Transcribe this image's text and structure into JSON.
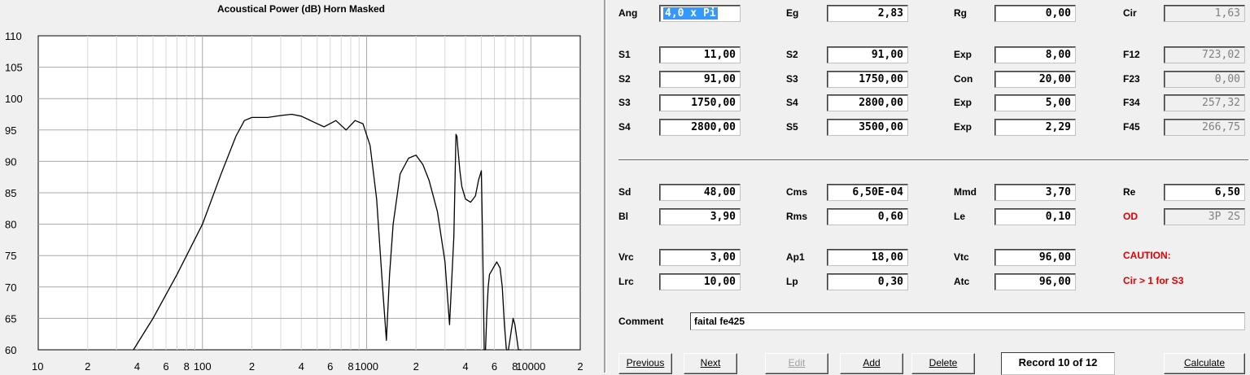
{
  "chart": {
    "title": "Acoustical Power (dB)   Horn   Masked"
  },
  "chart_data": {
    "type": "line",
    "title": "Acoustical Power (dB)   Horn   Masked",
    "xscale": "log",
    "xlim": [
      10,
      20000
    ],
    "ylim": [
      60,
      110
    ],
    "grid": true,
    "y_ticks": [
      110,
      105,
      100,
      95,
      90,
      85,
      80,
      75,
      70,
      65,
      60
    ],
    "x_tick_labels": [
      {
        "v": 10,
        "t": "10"
      },
      {
        "v": 20,
        "t": "2"
      },
      {
        "v": 40,
        "t": "4"
      },
      {
        "v": 60,
        "t": "6"
      },
      {
        "v": 80,
        "t": "8"
      },
      {
        "v": 100,
        "t": "100"
      },
      {
        "v": 200,
        "t": "2"
      },
      {
        "v": 400,
        "t": "4"
      },
      {
        "v": 600,
        "t": "6"
      },
      {
        "v": 800,
        "t": "8"
      },
      {
        "v": 1000,
        "t": "1000"
      },
      {
        "v": 2000,
        "t": "2"
      },
      {
        "v": 4000,
        "t": "4"
      },
      {
        "v": 6000,
        "t": "6"
      },
      {
        "v": 8000,
        "t": "8"
      },
      {
        "v": 10000,
        "t": "10000"
      },
      {
        "v": 20000,
        "t": "2"
      }
    ],
    "series": [
      {
        "color": "#000000",
        "x": [
          38,
          50,
          70,
          100,
          130,
          160,
          180,
          200,
          250,
          300,
          350,
          400,
          500,
          550,
          650,
          750,
          850,
          950,
          1050,
          1150,
          1250,
          1320,
          1380,
          1450,
          1600,
          1800,
          2000,
          2200,
          2400,
          2700,
          3000,
          3200,
          3400,
          3500,
          3550,
          3600,
          3700,
          3800,
          4000,
          4300,
          4600,
          4800,
          5000,
          5100,
          5200,
          5300,
          5400,
          5500,
          5600,
          5900,
          6200,
          6500,
          6700,
          6900,
          7100,
          7300,
          7400,
          7500,
          7600,
          7700,
          7800,
          8000,
          8200,
          8400,
          8500,
          8600,
          8700
        ],
        "y": [
          60,
          65,
          72,
          80,
          88,
          94,
          96.5,
          97,
          97,
          97.3,
          97.5,
          97.2,
          96,
          95.5,
          96.5,
          95,
          96.5,
          96,
          92.5,
          84,
          70,
          61.5,
          72,
          80,
          88,
          90.5,
          91,
          89.5,
          87,
          82,
          74,
          64,
          78,
          94.3,
          94,
          92,
          88.5,
          86,
          84,
          83.5,
          84.5,
          87,
          88.5,
          75,
          60,
          60,
          66,
          70,
          72,
          73,
          74,
          73,
          70,
          64,
          60,
          60,
          61,
          62,
          63,
          64,
          65,
          64,
          62,
          60,
          60,
          60,
          60
        ]
      }
    ]
  },
  "form": {
    "rows": [
      [
        {
          "label": "Ang",
          "value": "4,0 x Pi",
          "selected": true
        },
        {
          "label": "Eg",
          "value": "2,83"
        },
        {
          "label": "Rg",
          "value": "0,00"
        },
        {
          "label": "Cir",
          "value": "1,63",
          "readonly": true
        }
      ],
      [
        {
          "label": "S1",
          "value": "11,00"
        },
        {
          "label": "S2",
          "value": "91,00"
        },
        {
          "label": "Exp",
          "value": "8,00"
        },
        {
          "label": "F12",
          "value": "723,02",
          "readonly": true
        }
      ],
      [
        {
          "label": "S2",
          "value": "91,00"
        },
        {
          "label": "S3",
          "value": "1750,00"
        },
        {
          "label": "Con",
          "value": "20,00"
        },
        {
          "label": "F23",
          "value": "0,00",
          "readonly": true
        }
      ],
      [
        {
          "label": "S3",
          "value": "1750,00"
        },
        {
          "label": "S4",
          "value": "2800,00"
        },
        {
          "label": "Exp",
          "value": "5,00"
        },
        {
          "label": "F34",
          "value": "257,32",
          "readonly": true
        }
      ],
      [
        {
          "label": "S4",
          "value": "2800,00"
        },
        {
          "label": "S5",
          "value": "3500,00"
        },
        {
          "label": "Exp",
          "value": "2,29"
        },
        {
          "label": "F45",
          "value": "266,75",
          "readonly": true
        }
      ],
      [
        {
          "label": "Sd",
          "value": "48,00"
        },
        {
          "label": "Cms",
          "value": "6,50E-04"
        },
        {
          "label": "Mmd",
          "value": "3,70"
        },
        {
          "label": "Re",
          "value": "6,50"
        }
      ],
      [
        {
          "label": "Bl",
          "value": "3,90"
        },
        {
          "label": "Rms",
          "value": "0,60"
        },
        {
          "label": "Le",
          "value": "0,10"
        },
        {
          "label": "OD",
          "value": "3P 2S",
          "readonly": true,
          "red_label": true
        }
      ],
      [
        {
          "label": "Vrc",
          "value": "3,00"
        },
        {
          "label": "Ap1",
          "value": "18,00"
        },
        {
          "label": "Vtc",
          "value": "96,00"
        }
      ],
      [
        {
          "label": "Lrc",
          "value": "10,00"
        },
        {
          "label": "Lp",
          "value": "0,30"
        },
        {
          "label": "Atc",
          "value": "96,00"
        }
      ]
    ],
    "caution_title": "CAUTION:",
    "caution_text": "Cir > 1 for S3",
    "comment_label": "Comment",
    "comment_value": "faital fe425"
  },
  "buttons": {
    "previous": "Previous",
    "next": "Next",
    "edit": "Edit",
    "add": "Add",
    "delete": "Delete",
    "record": "Record 10 of 12",
    "calculate": "Calculate"
  },
  "colors": {
    "warning": "#e00000",
    "selection": "#3399ff"
  }
}
